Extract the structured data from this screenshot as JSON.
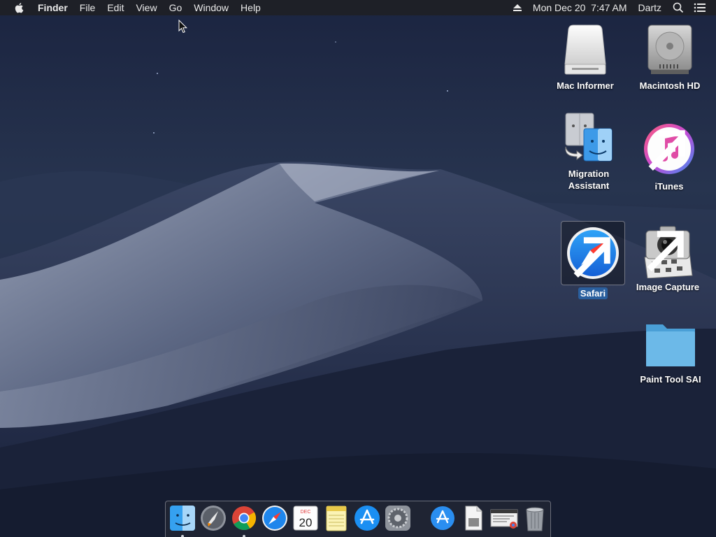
{
  "menubar": {
    "app_name": "Finder",
    "menus": [
      "File",
      "Edit",
      "View",
      "Go",
      "Window",
      "Help"
    ],
    "datetime": "Mon Dec 20  7:47 AM",
    "user": "Dartz",
    "icons": [
      "apple-icon",
      "eject-icon",
      "spotlight-icon",
      "control-strip-icon"
    ]
  },
  "desktop": {
    "icons": [
      {
        "label": "Mac Informer",
        "icon": "external-drive-icon"
      },
      {
        "label": "Macintosh HD",
        "icon": "hard-drive-icon"
      },
      {
        "label": "Migration\nAssistant",
        "label_line1": "Migration",
        "label_line2": "Assistant",
        "icon": "migration-assistant-icon"
      },
      {
        "label": "iTunes",
        "icon": "itunes-icon"
      },
      {
        "label": "Safari",
        "icon": "safari-icon",
        "selected": true
      },
      {
        "label": "Image Capture",
        "icon": "image-capture-icon"
      },
      {
        "label": "Paint Tool SAI",
        "icon": "folder-icon"
      }
    ]
  },
  "dock": {
    "apps": [
      {
        "name": "Finder",
        "icon": "finder-icon",
        "running": true
      },
      {
        "name": "Launchpad",
        "icon": "launchpad-icon",
        "running": false
      },
      {
        "name": "Google Chrome",
        "icon": "chrome-icon",
        "running": true
      },
      {
        "name": "Safari",
        "icon": "safari-icon",
        "running": false
      },
      {
        "name": "Calendar",
        "icon": "calendar-icon",
        "running": false,
        "month": "DEC",
        "day": "20"
      },
      {
        "name": "Notes",
        "icon": "notes-icon",
        "running": false
      },
      {
        "name": "App Store",
        "icon": "app-store-icon",
        "running": false
      },
      {
        "name": "System Preferences",
        "icon": "system-preferences-icon",
        "running": false
      }
    ],
    "others": [
      {
        "name": "Applications",
        "icon": "applications-folder-icon"
      },
      {
        "name": "Document",
        "icon": "document-icon"
      },
      {
        "name": "Chrome Downloads",
        "icon": "downloads-stack-icon"
      },
      {
        "name": "Trash",
        "icon": "trash-icon"
      }
    ]
  },
  "colors": {
    "menubar_bg": "#1e2026",
    "selection": "#2a5f9e",
    "folder": "#5aaee0"
  }
}
